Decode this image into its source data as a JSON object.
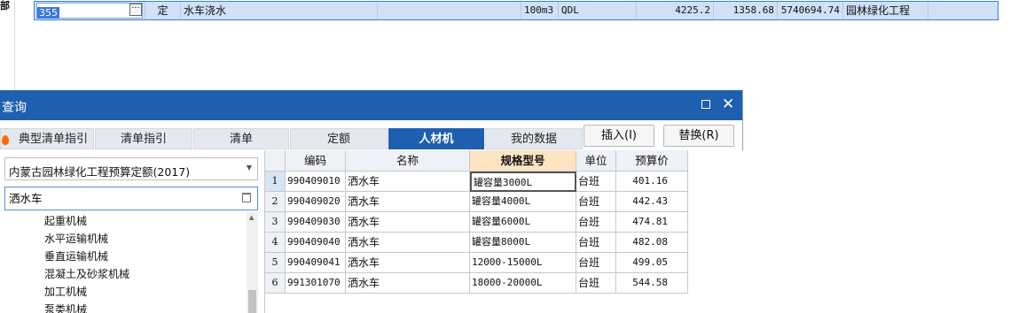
{
  "top_row": {
    "code": "355",
    "type": "定",
    "name": "水车浇水",
    "unit": "100m3",
    "qty_expr": "QDL",
    "price1": "4225.2",
    "price2": "1358.68",
    "total": "5740694.74",
    "category": "园林绿化工程"
  },
  "left_fragment": "部",
  "dialog": {
    "title": "查询",
    "tabs": [
      "典型清单指引",
      "清单指引",
      "清单",
      "定额",
      "人材机",
      "我的数据"
    ],
    "active_tab": "人材机",
    "insert_button": "插入(I)",
    "replace_button": "替换(R)",
    "quota_library": "内蒙古园林绿化工程预算定额(2017)",
    "search_value": "洒水车",
    "tree_items": [
      "起重机械",
      "水平运输机械",
      "垂直运输机械",
      "混凝土及砂浆机械",
      "加工机械",
      "泵类机械"
    ],
    "grid": {
      "headers": [
        "编码",
        "名称",
        "规格型号",
        "单位",
        "预算价"
      ],
      "rows": [
        {
          "n": "1",
          "code": "990409010",
          "name": "洒水车",
          "spec": "罐容量3000L",
          "unit": "台班",
          "price": "401.16"
        },
        {
          "n": "2",
          "code": "990409020",
          "name": "洒水车",
          "spec": "罐容量4000L",
          "unit": "台班",
          "price": "442.43"
        },
        {
          "n": "3",
          "code": "990409030",
          "name": "洒水车",
          "spec": "罐容量6000L",
          "unit": "台班",
          "price": "474.81"
        },
        {
          "n": "4",
          "code": "990409040",
          "name": "洒水车",
          "spec": "罐容量8000L",
          "unit": "台班",
          "price": "482.08"
        },
        {
          "n": "5",
          "code": "990409041",
          "name": "洒水车",
          "spec": "12000-15000L",
          "unit": "台班",
          "price": "499.05"
        },
        {
          "n": "6",
          "code": "991301070",
          "name": "洒水车",
          "spec": "18000-20000L",
          "unit": "台班",
          "price": "544.58"
        }
      ]
    }
  },
  "colors": {
    "accent": "#1f5fb0",
    "row_highlight": "#cfe0f7",
    "header_highlight": "#fde5c4"
  }
}
